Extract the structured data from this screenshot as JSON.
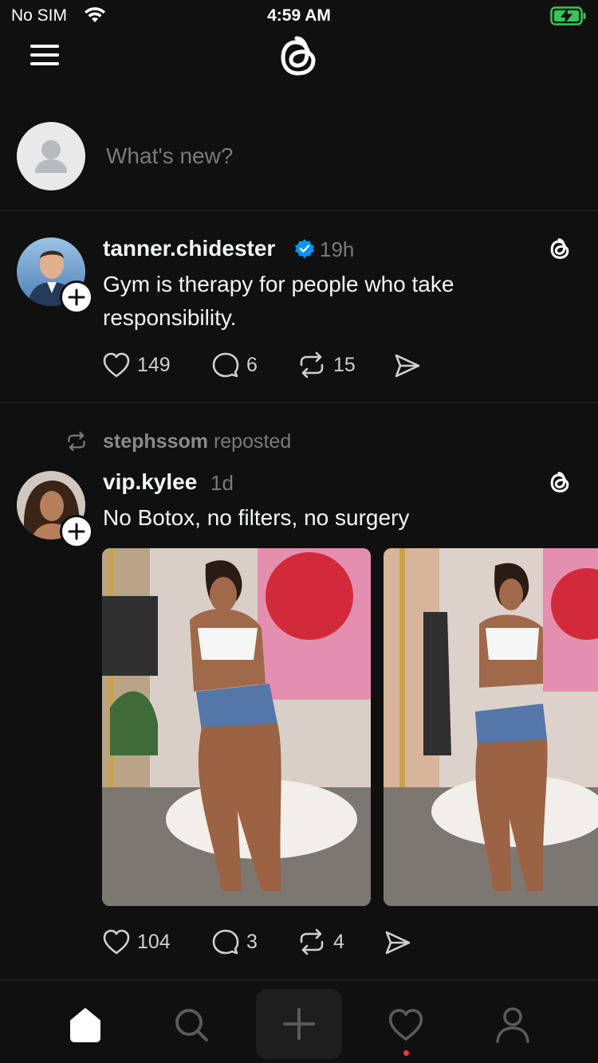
{
  "status_bar": {
    "carrier": "No SIM",
    "time": "4:59 AM"
  },
  "composer": {
    "placeholder": "What's new?"
  },
  "posts": [
    {
      "username": "tanner.chidester",
      "verified": true,
      "time": "19h",
      "text_line1": "Gym is therapy for people who take",
      "text_line2": "responsibility.",
      "likes": "149",
      "comments": "6",
      "reposts": "15"
    },
    {
      "reposted_by": "stephssom",
      "reposted_label": "reposted",
      "username": "vip.kylee",
      "time": "1d",
      "text": "No Botox, no filters, no surgery",
      "likes": "104",
      "comments": "3",
      "reposts": "4"
    }
  ],
  "tab_bar": {
    "tabs": [
      "home",
      "search",
      "create",
      "activity",
      "profile"
    ],
    "activity_badge_color": "#ff3040"
  },
  "colors": {
    "background": "#101010",
    "text": "#f3f5f7",
    "muted": "#7a7a7a",
    "verified": "#0095f6",
    "battery": "#34c759"
  }
}
